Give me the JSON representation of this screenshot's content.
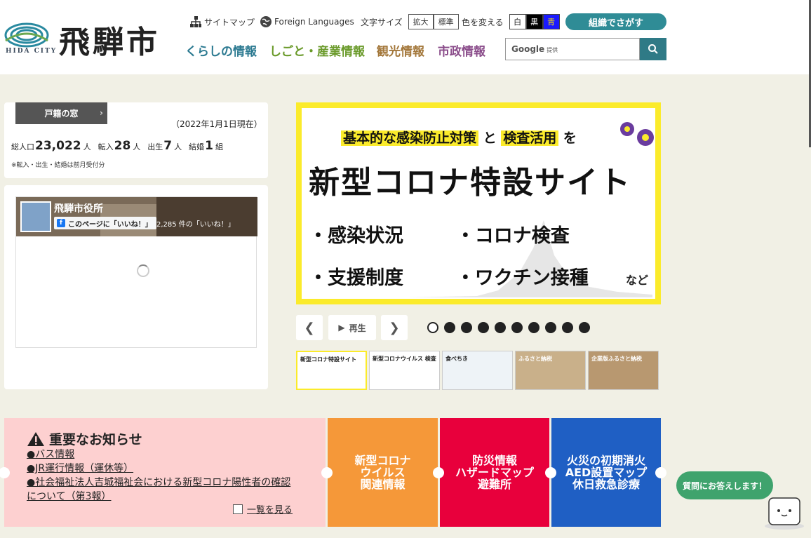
{
  "header": {
    "logo_kanji": "飛騨市",
    "logo_city": "HIDA CITY",
    "sitemap": "サイトマップ",
    "foreign": "Foreign Languages",
    "textsize_label": "文字サイズ",
    "textsize_large": "拡大",
    "textsize_normal": "標準",
    "color_label": "色を変える",
    "color_white": "白",
    "color_black": "黒",
    "color_blue": "青",
    "org_search": "組織でさがす",
    "search_brand": "Google",
    "search_provided": "提供"
  },
  "nav": [
    {
      "label": "くらしの情報",
      "color": "#2c7a91"
    },
    {
      "label": "しごと・産業情報",
      "color": "#6a9a2a"
    },
    {
      "label": "観光情報",
      "color": "#a3773a"
    },
    {
      "label": "市政情報",
      "color": "#8a4c8a"
    }
  ],
  "stats": {
    "koseki": "戸籍の窓",
    "as_of": "（2022年1月1日現在）",
    "pop_label": "総人口",
    "pop": "23,022",
    "pop_unit": "人",
    "in_label": "転入",
    "in": "28",
    "in_unit": "人",
    "birth_label": "出生",
    "birth": "7",
    "birth_unit": "人",
    "marry_label": "結婚",
    "marry": "1",
    "marry_unit": "組",
    "note": "※転入・出生・結婚は前月受付分"
  },
  "facebook": {
    "name": "飛騨市役所",
    "like": "このページに「いいね！」",
    "count": "2,285 件の「いいね！」"
  },
  "slide": {
    "line1a": "基本的な感染防止対策",
    "line1b": "と",
    "line1c": "検査活用",
    "line1d": "を",
    "big": "新型コロナ特設サイト",
    "item1": "・感染状況",
    "item2": "・コロナ検査",
    "item3": "・支援制度",
    "item4": "・ワクチン接種",
    "nado": "など",
    "play": "再生",
    "dots": 10,
    "active_dot": 1
  },
  "thumbs": [
    {
      "text": "新型コロナ特設サイト"
    },
    {
      "text": "新型コロナウイルス 検査"
    },
    {
      "text": "食べちき"
    },
    {
      "text": "ふるさと納税"
    },
    {
      "text": "企業版ふるさと納税"
    }
  ],
  "notice": {
    "title": "重要なお知らせ",
    "items": [
      "●バス情報",
      "●JR運行情報（運休等）",
      "●社会福祉法人吉城福祉会における新型コロナ陽性者の確認について（第3報）"
    ],
    "more": "一覧を見る"
  },
  "tiles": {
    "covid": "新型コロナ\nウイルス\n関連情報",
    "disaster": "防災情報\nハザードマップ\n避難所",
    "fire": "火災の初期消火\nAED設置マップ\n休日救急診療"
  },
  "chatbot": "質問にお答えします！"
}
